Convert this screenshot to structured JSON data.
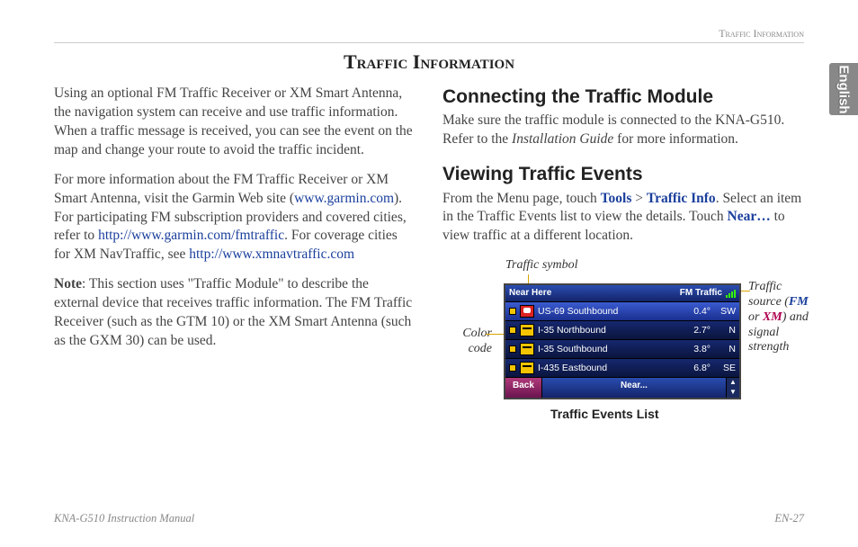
{
  "header": {
    "section": "Traffic Information"
  },
  "title": "Traffic Information",
  "sideTab": "English",
  "left": {
    "p1": "Using an optional FM Traffic Receiver or XM Smart Antenna, the navigation system can receive and use traffic information. When a traffic message is received, you can see the event on the map and change your route to avoid the traffic incident.",
    "p2a": "For more information about the FM Traffic Receiver or XM Smart Antenna, visit the Garmin Web site (",
    "p2_link1": "www.garmin.com",
    "p2b": "). For participating FM subscription providers and covered cities, refer to ",
    "p2_link2": "http://www.garmin.com/fmtraffic",
    "p2c": ". For coverage cities for XM NavTraffic, see ",
    "p2_link3": "http://www.xmnavtraffic.com",
    "p3_note": "Note",
    "p3": ": This section uses \"Traffic Module\" to describe the external device that receives traffic information. The FM Traffic Receiver (such as the GTM 10) or the XM Smart Antenna (such as the GXM 30) can be used."
  },
  "right": {
    "h1": "Connecting the Traffic Module",
    "p1a": "Make sure the traffic module is connected to the KNA-G510. Refer to the ",
    "p1_em": "Installation Guide",
    "p1b": " for more information.",
    "h2": "Viewing Traffic Events",
    "p2a": "From the Menu page, touch ",
    "p2_b1": "Tools",
    "p2_gt": " > ",
    "p2_b2": "Traffic Info",
    "p2b": ". Select an item in the Traffic Events list to view the details. Touch ",
    "p2_b3": "Near…",
    "p2c": " to view traffic at a different location."
  },
  "figure": {
    "callout_symbol": "Traffic symbol",
    "callout_color": "Color code",
    "callout_source_1": "Traffic source (",
    "callout_source_fm": "FM",
    "callout_source_or": " or ",
    "callout_source_xm": "XM",
    "callout_source_2": ") and signal strength",
    "caption": "Traffic Events List",
    "device": {
      "titleLeft": "Near Here",
      "titleRight": "FM Traffic",
      "rows": [
        {
          "name": "US-69 Southbound",
          "dist": "0.4°",
          "dir": "SW"
        },
        {
          "name": "I-35 Northbound",
          "dist": "2.7°",
          "dir": "N"
        },
        {
          "name": "I-35 Southbound",
          "dist": "3.8°",
          "dir": "N"
        },
        {
          "name": "I-435 Eastbound",
          "dist": "6.8°",
          "dir": "SE"
        }
      ],
      "back": "Back",
      "near": "Near..."
    }
  },
  "footer": {
    "left": "KNA-G510 Instruction Manual",
    "right": "EN-27"
  }
}
